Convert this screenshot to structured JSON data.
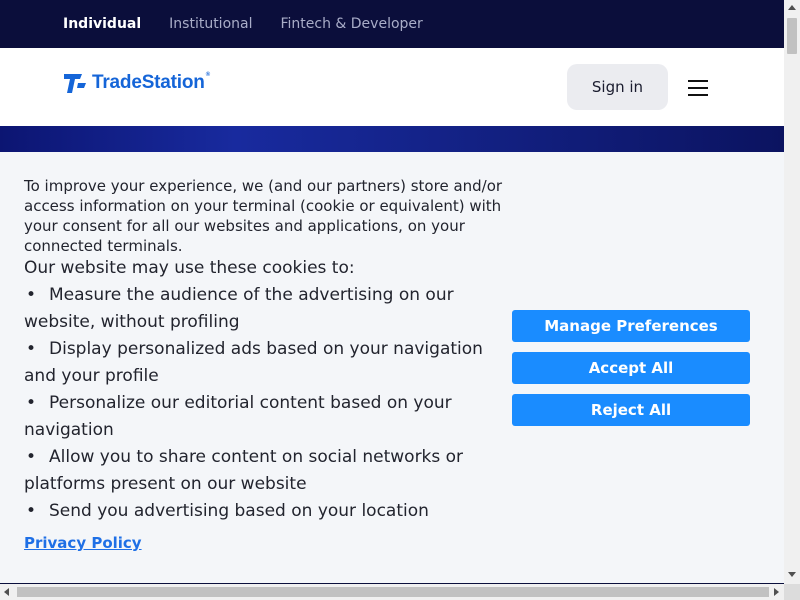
{
  "audience_nav": {
    "items": [
      {
        "label": "Individual",
        "active": true
      },
      {
        "label": "Institutional",
        "active": false
      },
      {
        "label": "Fintech & Developer",
        "active": false
      }
    ]
  },
  "header": {
    "logo_text": "TradeStation",
    "logo_mark": "®",
    "sign_in_label": "Sign in",
    "menu_icon": "hamburger-icon"
  },
  "cookie_banner": {
    "intro": "To improve your experience, we (and our partners) store and/or access information on your terminal (cookie or equivalent) with your consent for all our websites and applications, on your connected terminals.",
    "lead": "Our website may use these cookies to:",
    "purposes": [
      "Measure the audience of the advertising on our website, without profiling",
      "Display personalized ads based on your navigation and your profile",
      "Personalize our editorial content based on your navigation",
      "Allow you to share content on social networks or platforms present on our website",
      "Send you advertising based on your location"
    ],
    "privacy_link": "Privacy Policy",
    "buttons": {
      "manage": "Manage Preferences",
      "accept": "Accept All",
      "reject": "Reject All"
    }
  },
  "colors": {
    "topbar": "#0b0e3b",
    "brand_blue": "#1565d8",
    "button_blue": "#1a8cff",
    "banner_bg": "#f4f6f9"
  }
}
